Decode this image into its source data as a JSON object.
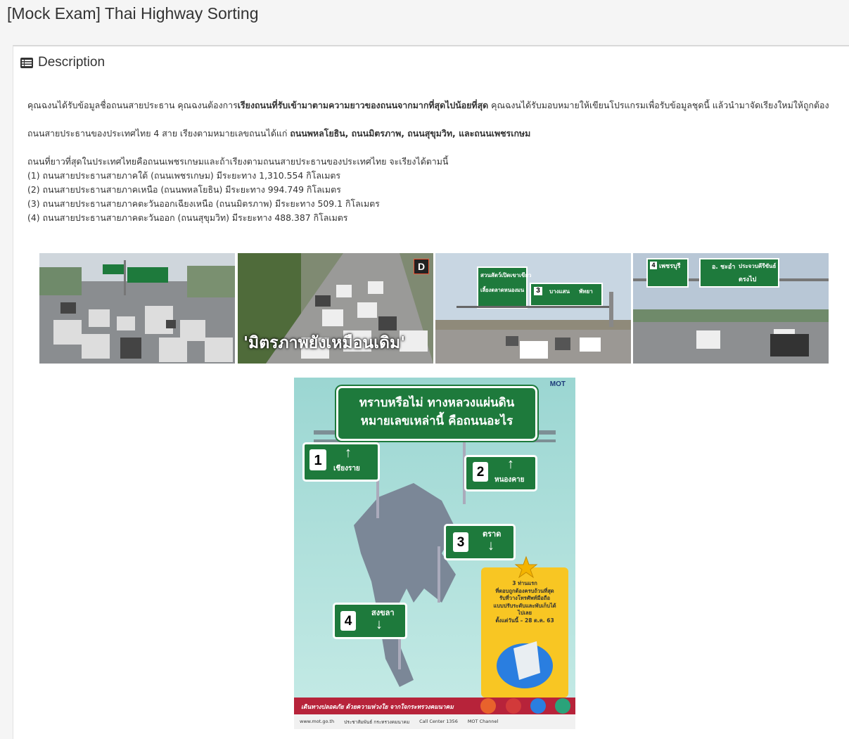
{
  "page": {
    "title": "[Mock Exam] Thai Highway Sorting"
  },
  "panel": {
    "heading": "Description",
    "heading_icon": "list-icon"
  },
  "description": {
    "p1_a": "คุณฉงนได้รับข้อมูลชื่อถนนสายประธาน คุณฉงนต้องการ",
    "p1_bold": "เรียงถนนที่รับเข้ามาตามความยาวของถนนจากมากที่สุดไปน้อยที่สุด",
    "p1_b": " คุณฉงนได้รับมอบหมายให้เขียนโปรแกรมเพื่อรับข้อมูลชุดนี้ แล้วนำมาจัดเรียงใหม่ให้ถูกต้อง",
    "p2_a": "ถนนสายประธานของประเทศไทย 4 สาย เรียงตามหมายเลขถนนได้แก่ ",
    "p2_bold": "ถนนพหลโยธิน, ถนนมิตรภาพ, ถนนสุขุมวิท, และถนนเพชรเกษม",
    "p3_intro": "ถนนที่ยาวที่สุดในประเทศไทยคือถนนเพชรเกษมและถ้าเรียงตามถนนสายประธานของประเทศไทย จะเรียงได้ตามนี้",
    "list": [
      "(1) ถนนสายประธานสายภาคใต้ (ถนนเพชรเกษม) มีระยะทาง 1,310.554 กิโลเมตร",
      "(2) ถนนสายประธานสายภาคเหนือ (ถนนพหลโยธิน) มีระยะทาง 994.749 กิโลเมตร",
      "(3) ถนนสายประธานสายภาคตะวันออกเฉียงเหนือ (ถนนมิตรภาพ) มีระยะทาง 509.1 กิโลเมตร",
      "(4) ถนนสายประธานสายภาคตะวันออก (ถนนสุขุมวิท) มีระยะทาง 488.387 กิโลเมตร"
    ]
  },
  "photos": {
    "p2_caption": "'มิตรภาพยังเหมือนเดิม'",
    "p2_badge": "D",
    "p3_sign_left": "สวนสัตว์เปิดเขาเขียว",
    "p3_sign_left_sub": "เลี้ยงตลาดหนองมน",
    "p3_sign_num": "3",
    "p3_sign_right_a": "บางแสน",
    "p3_sign_right_b": "พัทยา",
    "p4_sign_left": "เพชรบุรี",
    "p4_sign_left_num": "4",
    "p4_sign_right_a": "อ. ชะอำ",
    "p4_sign_right_b": "ประจวบคีรีขันธ์",
    "p4_sign_right_c": "ตรงไป"
  },
  "infographic": {
    "title_line1": "ทราบหรือไม่ ทางหลวงแผ่นดิน",
    "title_line2": "หมายเลขเหล่านี้ คือถนนอะไร",
    "logo": "MOT",
    "signs": [
      {
        "num": "1",
        "label": "เชียงราย"
      },
      {
        "num": "2",
        "label": "หนองคาย"
      },
      {
        "num": "3",
        "label": "ตราด"
      },
      {
        "num": "4",
        "label": "สงขลา"
      }
    ],
    "promo_lines": [
      "3 ท่านแรก",
      "ที่ตอบถูกต้องครบถ้วนที่สุด",
      "รับที่วางโทรศัพท์มือถือ",
      "แบบปรับระดับและพับเก็บได้",
      "ไปเลย",
      "ตั้งแต่วันนี้ – 28 ต.ค. 63"
    ],
    "footer_slogan": "เดินทางปลอดภัย ด้วยความห่วงใย จากใจกระทรวงคมนาคม",
    "footer_links": [
      "www.mot.go.th",
      "ประชาสัมพันธ์ กระทรวงคมนาคม",
      "Call Center 1356",
      "MOT Channel"
    ]
  },
  "colors": {
    "sign_green": "#1e7a3c",
    "infographic_bg": "#a8dcd8",
    "footer_red": "#b7233a",
    "promo_yellow": "#f8c623"
  }
}
